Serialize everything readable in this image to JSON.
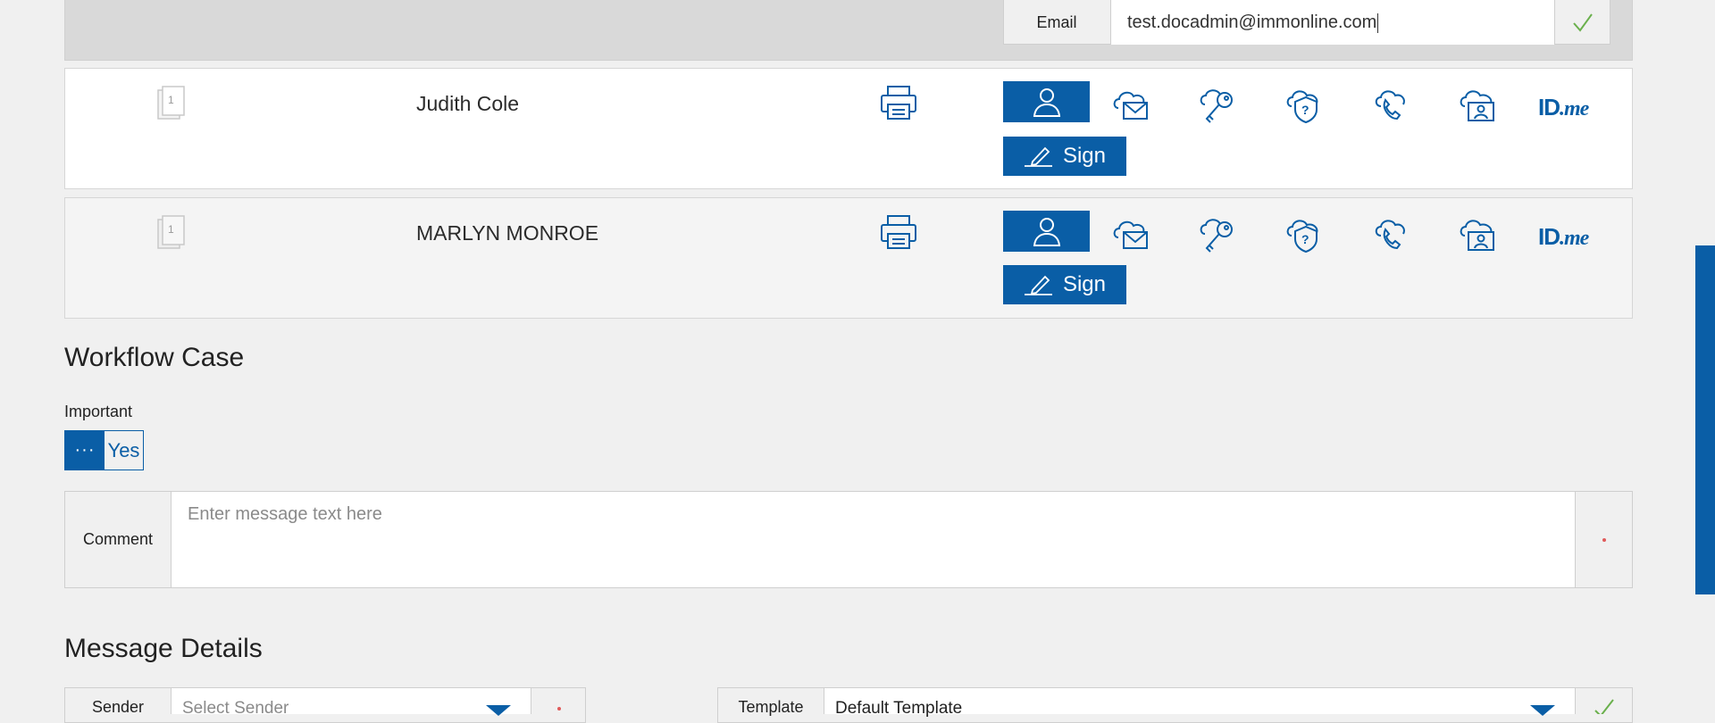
{
  "email_row": {
    "label": "Email",
    "value": "test.docadmin@immonline.com"
  },
  "signers": [
    {
      "page_count": "1",
      "name": "Judith Cole",
      "sign_label": "Sign",
      "idme_brand": "ID",
      "idme_suffix": ".me"
    },
    {
      "page_count": "1",
      "name": "MARLYN MONROE",
      "sign_label": "Sign",
      "idme_brand": "ID",
      "idme_suffix": ".me"
    }
  ],
  "auth_icons": [
    "person-icon",
    "cloud-mail-icon",
    "key-icon",
    "shield-question-icon",
    "phone-icon",
    "cloud-id-icon",
    "idme-logo"
  ],
  "workflow": {
    "title": "Workflow Case",
    "important_label": "Important",
    "toggle_dots": "···",
    "toggle_value": "Yes",
    "comment_label": "Comment",
    "comment_placeholder": "Enter message text here"
  },
  "message_details": {
    "title": "Message Details",
    "sender_label": "Sender",
    "sender_placeholder": "Select Sender",
    "template_label": "Template",
    "template_value": "Default Template"
  },
  "colors": {
    "primary": "#0a5ea6",
    "valid": "#6ab04c",
    "required": "#e05a5a",
    "background": "#f0f0f0"
  }
}
